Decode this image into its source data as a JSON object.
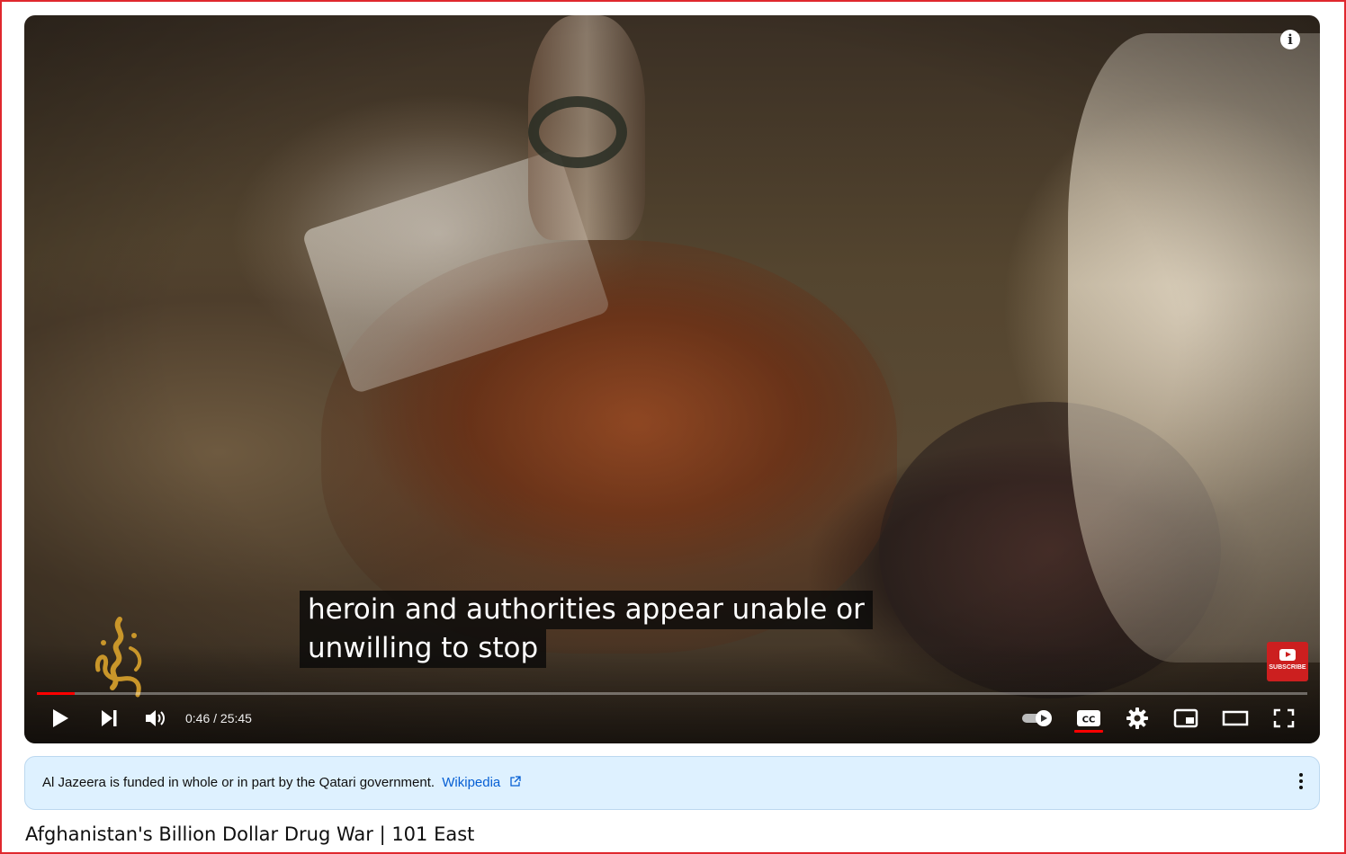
{
  "player": {
    "caption_line_1": "heroin and authorities appear unable or",
    "caption_line_2": "unwilling to stop",
    "time_display": "0:46 / 25:45",
    "progress_fraction": 0.0298,
    "subscribe_label": "SUBSCRIBE",
    "accent_color": "#ff0000",
    "icons": {
      "info": "info-icon",
      "play": "play-icon",
      "next": "next-icon",
      "volume": "volume-icon",
      "autoplay": "autoplay-toggle-icon",
      "cc": "closed-captions-icon",
      "settings": "gear-icon",
      "miniplayer": "miniplayer-icon",
      "theater": "theater-mode-icon",
      "fullscreen": "fullscreen-icon"
    }
  },
  "notice": {
    "text": "Al Jazeera is funded in whole or in part by the Qatari government.",
    "link": "Wikipedia",
    "background": "#def1ff"
  },
  "video": {
    "title": "Afghanistan's Billion Dollar Drug War | 101 East"
  }
}
